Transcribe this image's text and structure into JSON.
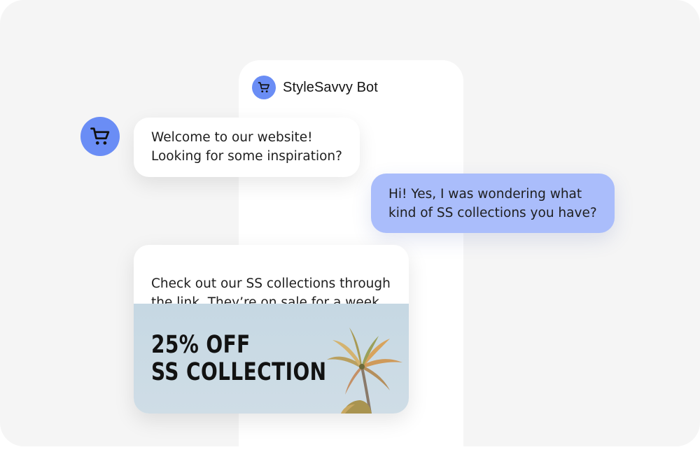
{
  "bot": {
    "name": "StyleSavvy Bot",
    "avatar_icon": "shopping-cart-icon",
    "avatar_color": "#6a8df5"
  },
  "messages": [
    {
      "sender": "bot",
      "text": "Welcome to our website!\nLooking for some inspiration?"
    },
    {
      "sender": "user",
      "text": "Hi! Yes, I was wondering what\nkind of SS collections you have?"
    },
    {
      "sender": "bot",
      "text": "Check out our SS collections through\nthe link. They’re on sale for a week.",
      "promo": {
        "headline": "25% OFF\nSS COLLECTION",
        "image": "palm-tree-image"
      }
    }
  ],
  "colors": {
    "background": "#f5f5f5",
    "user_bubble": "#aabdfb",
    "bot_bubble": "#ffffff",
    "promo_sky": "#c6d8e3"
  }
}
